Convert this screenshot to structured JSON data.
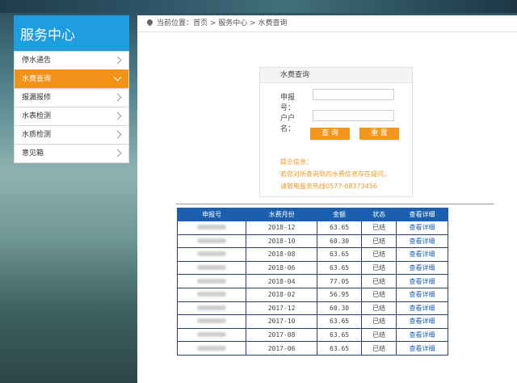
{
  "sidebar": {
    "title": "服务中心",
    "items": [
      {
        "label": "停水通告",
        "active": false
      },
      {
        "label": "水费查询",
        "active": true
      },
      {
        "label": "报漏报修",
        "active": false
      },
      {
        "label": "水表检测",
        "active": false
      },
      {
        "label": "水质检测",
        "active": false
      },
      {
        "label": "意见箱",
        "active": false
      }
    ]
  },
  "breadcrumb": "当前位置：首页 > 服务中心 > 水费查询",
  "query": {
    "title": "水费查询",
    "account_label": "申报号：",
    "name_label": "户户名：",
    "query_button": "查 询",
    "reset_button": "重 置",
    "tips": [
      "提示信息：",
      "若您对所查询到的水费信息存在疑问，",
      "请致电服务热线0577-88373456"
    ]
  },
  "table": {
    "headers": [
      "申报号",
      "水费月份",
      "金额",
      "状态",
      "查看详细"
    ],
    "rows": [
      {
        "month": "2018-12",
        "amount": "63.65",
        "status": "已结",
        "detail": "查看详细"
      },
      {
        "month": "2018-10",
        "amount": "60.30",
        "status": "已结",
        "detail": "查看详细"
      },
      {
        "month": "2018-08",
        "amount": "63.65",
        "status": "已结",
        "detail": "查看详细"
      },
      {
        "month": "2018-06",
        "amount": "63.65",
        "status": "已结",
        "detail": "查看详细"
      },
      {
        "month": "2018-04",
        "amount": "77.05",
        "status": "已结",
        "detail": "查看详细"
      },
      {
        "month": "2018-02",
        "amount": "56.95",
        "status": "已结",
        "detail": "查看详细"
      },
      {
        "month": "2017-12",
        "amount": "60.30",
        "status": "已结",
        "detail": "查看详细"
      },
      {
        "month": "2017-10",
        "amount": "63.65",
        "status": "已结",
        "detail": "查看详细"
      },
      {
        "month": "2017-08",
        "amount": "63.65",
        "status": "已结",
        "detail": "查看详细"
      },
      {
        "month": "2017-06",
        "amount": "63.65",
        "status": "已结",
        "detail": "查看详细"
      }
    ]
  },
  "colors": {
    "accent_blue": "#1e9ee0",
    "active_orange": "#f39219",
    "table_header": "#1c5fae",
    "tips": "#e89a2a"
  }
}
